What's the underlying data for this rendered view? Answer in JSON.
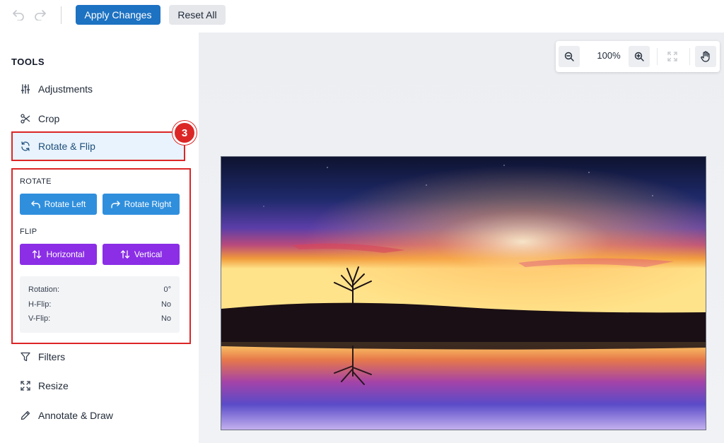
{
  "toolbar": {
    "undo_icon": "undo-icon",
    "redo_icon": "redo-icon",
    "apply_label": "Apply Changes",
    "reset_label": "Reset All"
  },
  "sidebar": {
    "title": "TOOLS",
    "items": [
      {
        "label": "Adjustments",
        "icon": "sliders-icon"
      },
      {
        "label": "Crop",
        "icon": "scissors-icon"
      },
      {
        "label": "Rotate & Flip",
        "icon": "rotate-icon",
        "active": true
      },
      {
        "label": "Filters",
        "icon": "funnel-icon"
      },
      {
        "label": "Resize",
        "icon": "expand-icon"
      },
      {
        "label": "Annotate & Draw",
        "icon": "pencil-icon"
      }
    ],
    "step_badge": "3"
  },
  "rotate_panel": {
    "rotate_label": "ROTATE",
    "rotate_left": "Rotate Left",
    "rotate_right": "Rotate Right",
    "flip_label": "FLIP",
    "flip_horizontal": "Horizontal",
    "flip_vertical": "Vertical",
    "info": {
      "rotation_label": "Rotation:",
      "rotation_value": "0°",
      "hflip_label": "H-Flip:",
      "hflip_value": "No",
      "vflip_label": "V-Flip:",
      "vflip_value": "No"
    }
  },
  "canvas": {
    "zoom_level": "100%",
    "zoom_out_icon": "zoom-out-icon",
    "zoom_in_icon": "zoom-in-icon",
    "fit_icon": "fit-screen-icon",
    "pan_icon": "hand-icon"
  },
  "colors": {
    "primary": "#1d72c2",
    "rotate_buttons": "#2f8fdd",
    "flip_buttons": "#8b2ee6",
    "highlight": "#dc2626"
  }
}
